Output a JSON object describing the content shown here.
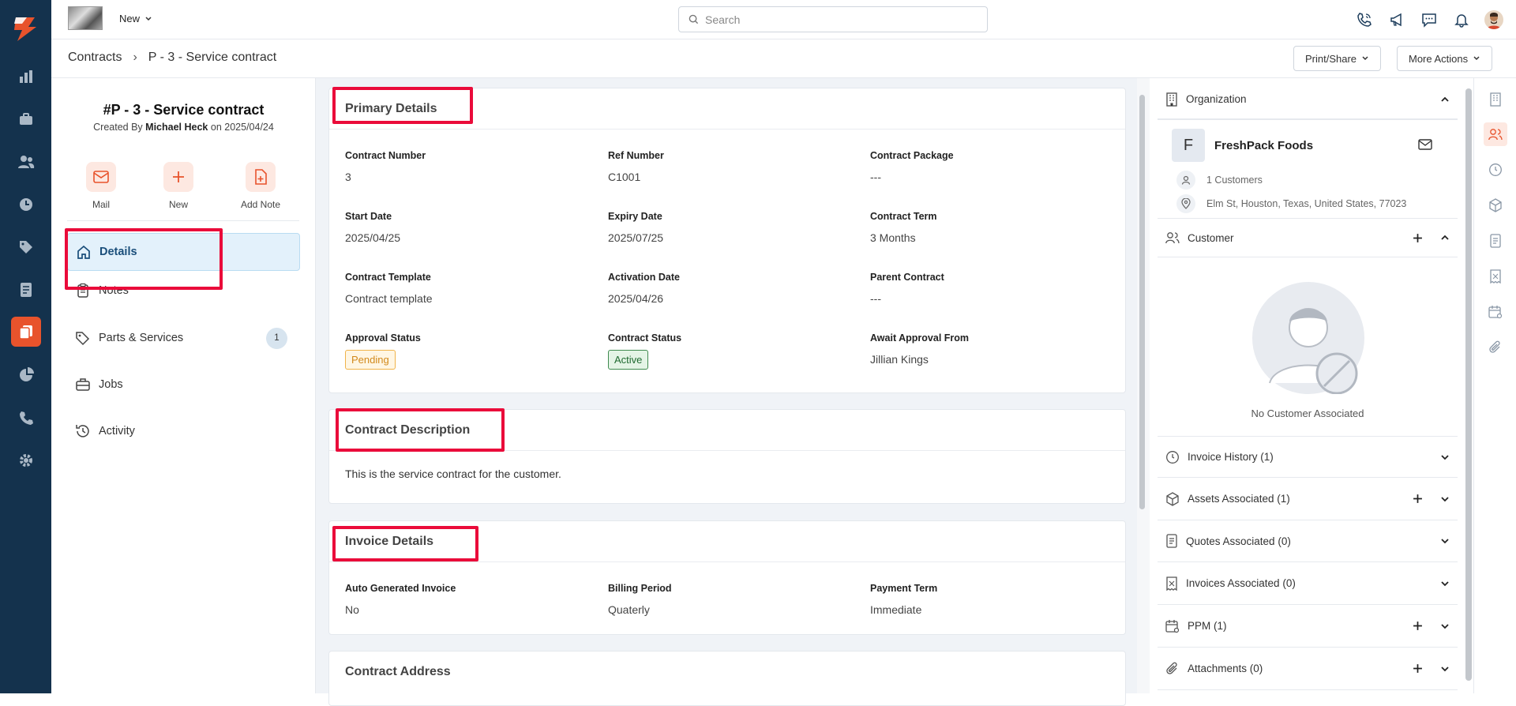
{
  "topbar": {
    "new_label": "New",
    "search_placeholder": "Search"
  },
  "breadcrumb": {
    "root": "Contracts",
    "current": "P - 3 - Service contract"
  },
  "header_actions": {
    "print_share": "Print/Share",
    "more_actions": "More Actions"
  },
  "left": {
    "title": "#P - 3 - Service contract",
    "created_prefix": "Created By",
    "created_by": "Michael Heck",
    "created_on_prefix": "on",
    "created_date": "2025/04/24",
    "quick_actions": [
      "Mail",
      "New",
      "Add Note"
    ],
    "nav": [
      {
        "label": "Details"
      },
      {
        "label": "Notes"
      },
      {
        "label": "Parts & Services",
        "badge": "1"
      },
      {
        "label": "Jobs"
      },
      {
        "label": "Activity"
      }
    ]
  },
  "primary": {
    "title": "Primary Details",
    "fields": [
      {
        "label": "Contract Number",
        "value": "3"
      },
      {
        "label": "Ref Number",
        "value": "C1001"
      },
      {
        "label": "Contract Package",
        "value": "---"
      },
      {
        "label": "Start Date",
        "value": "2025/04/25"
      },
      {
        "label": "Expiry Date",
        "value": "2025/07/25"
      },
      {
        "label": "Contract Term",
        "value": "3 Months"
      },
      {
        "label": "Contract Template",
        "value": "Contract template"
      },
      {
        "label": "Activation Date",
        "value": "2025/04/26"
      },
      {
        "label": "Parent Contract",
        "value": "---"
      },
      {
        "label": "Approval Status",
        "value": "Pending"
      },
      {
        "label": "Contract Status",
        "value": "Active"
      },
      {
        "label": "Await Approval From",
        "value": "Jillian Kings"
      }
    ]
  },
  "description": {
    "title": "Contract Description",
    "text": "This is the service contract for the customer."
  },
  "invoice": {
    "title": "Invoice Details",
    "fields": [
      {
        "label": "Auto Generated Invoice",
        "value": "No"
      },
      {
        "label": "Billing Period",
        "value": "Quaterly"
      },
      {
        "label": "Payment Term",
        "value": "Immediate"
      }
    ]
  },
  "address": {
    "title": "Contract Address"
  },
  "right": {
    "organization": {
      "title": "Organization",
      "initial": "F",
      "name": "FreshPack Foods",
      "customers": "1 Customers",
      "address": "Elm St, Houston, Texas, United States, 77023"
    },
    "customer": {
      "title": "Customer",
      "empty": "No Customer Associated"
    },
    "sections": [
      "Invoice History (1)",
      "Assets Associated (1)",
      "Quotes Associated (0)",
      "Invoices Associated (0)",
      "PPM (1)",
      "Attachments (0)"
    ]
  },
  "colors": {
    "accent": "#e8532c",
    "rail": "#14324d",
    "highlight": "#ea0b3a"
  }
}
